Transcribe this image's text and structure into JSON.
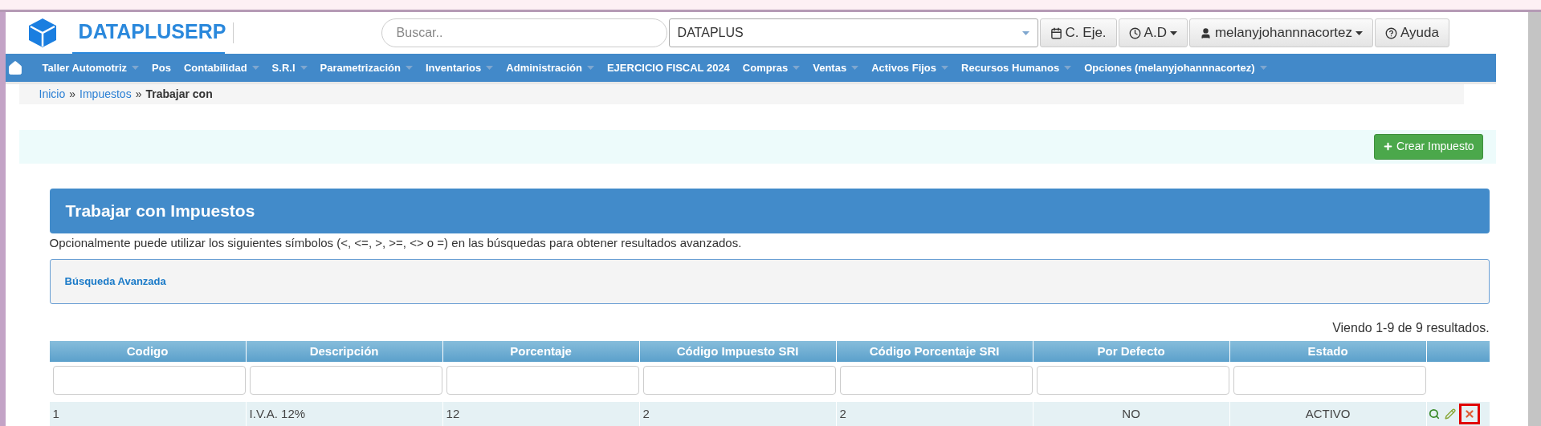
{
  "header": {
    "brand": "DATAPLUSERP",
    "search": {
      "placeholder": "Buscar.."
    },
    "company_select": {
      "value": "DATAPLUS"
    },
    "buttons": [
      {
        "kind": "calendar",
        "label": "C. Eje.",
        "dropdown": false
      },
      {
        "kind": "clock",
        "label": "A.D",
        "dropdown": true
      },
      {
        "kind": "user",
        "label": "melanyjohannnacortez",
        "dropdown": true
      },
      {
        "kind": "help",
        "label": "Ayuda",
        "dropdown": false
      }
    ]
  },
  "menu": [
    {
      "label": "Taller Automotriz",
      "dropdown": true
    },
    {
      "label": "Pos",
      "dropdown": false
    },
    {
      "label": "Contabilidad",
      "dropdown": true
    },
    {
      "label": "S.R.I",
      "dropdown": true
    },
    {
      "label": "Parametrización",
      "dropdown": true
    },
    {
      "label": "Inventarios",
      "dropdown": true
    },
    {
      "label": "Administración",
      "dropdown": true
    },
    {
      "label": "EJERCICIO FISCAL 2024",
      "dropdown": false
    },
    {
      "label": "Compras",
      "dropdown": true
    },
    {
      "label": "Ventas",
      "dropdown": true
    },
    {
      "label": "Activos Fijos",
      "dropdown": true
    },
    {
      "label": "Recursos Humanos",
      "dropdown": true
    },
    {
      "label": "Opciones (melanyjohannnacortez)",
      "dropdown": true
    }
  ],
  "breadcrumb": [
    {
      "kind": "link",
      "text": "Inicio"
    },
    {
      "kind": "sep",
      "text": "»"
    },
    {
      "kind": "link",
      "text": "Impuestos"
    },
    {
      "kind": "sep",
      "text": "»"
    },
    {
      "kind": "current",
      "text": "Trabajar con"
    }
  ],
  "create_button": "Crear Impuesto",
  "panel": {
    "title": "Trabajar con Impuestos",
    "hint": "Opcionalmente puede utilizar los siguientes símbolos (<, <=, >, >=, <> o =) en las búsquedas para obtener resultados avanzados.",
    "advanced_search": "Búsqueda Avanzada"
  },
  "table": {
    "summary": "Viendo 1-9 de 9 resultados.",
    "columns": [
      "Codigo",
      "Descripción",
      "Porcentaje",
      "Código Impuesto SRI",
      "Código Porcentaje SRI",
      "Por Defecto",
      "Estado"
    ],
    "rows": [
      {
        "cells": [
          "1",
          "I.V.A. 12%",
          "12",
          "2",
          "2",
          "NO",
          "ACTIVO"
        ],
        "actions": [
          {
            "kind": "view",
            "highlighted": false
          },
          {
            "kind": "edit",
            "highlighted": false
          },
          {
            "kind": "delete",
            "highlighted": true
          }
        ]
      }
    ]
  }
}
